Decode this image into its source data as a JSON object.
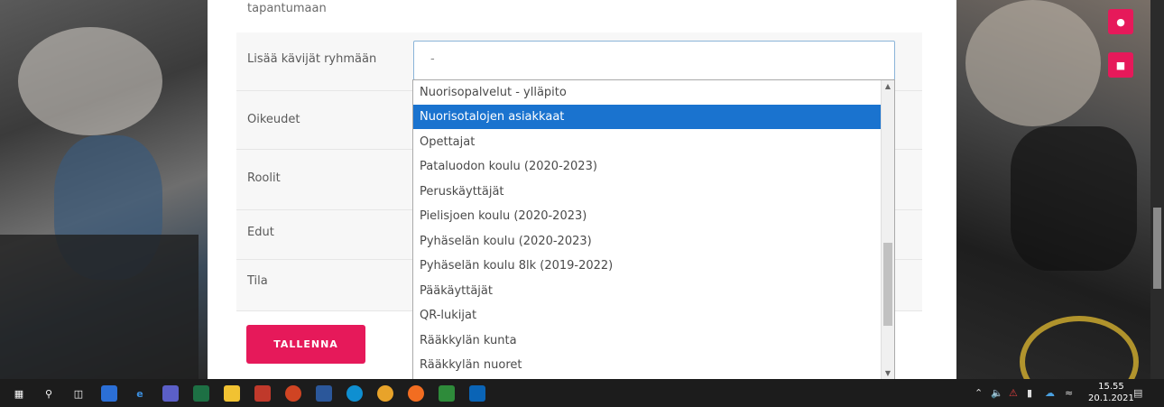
{
  "form": {
    "top_text": "tapantumaan",
    "rows": [
      {
        "label": "Lisää kävijät ryhmään"
      },
      {
        "label": "Oikeudet"
      },
      {
        "label": "Roolit"
      },
      {
        "label": "Edut"
      },
      {
        "label": "Tila"
      }
    ],
    "select_value": "-",
    "save_label": "TALLENNA"
  },
  "dropdown": {
    "options": [
      "Nuorisopalvelut - ylläpito",
      "Nuorisotalojen asiakkaat",
      "Opettajat",
      "Pataluodon koulu (2020-2023)",
      "Peruskäyttäjät",
      "Pielisjoen koulu (2020-2023)",
      "Pyhäselän koulu (2020-2023)",
      "Pyhäselän koulu 8lk (2019-2022)",
      "Pääkäyttäjät",
      "QR-lukijat",
      "Rääkkylän kunta",
      "Rääkkylän nuoret"
    ],
    "selected_index": 1,
    "colors": {
      "selected": "#1a73cf"
    }
  },
  "accent_color": "#e6195a",
  "taskbar": {
    "icons": [
      "windows-icon",
      "search-icon",
      "task-view-icon",
      "store-icon",
      "edge-legacy-icon",
      "teams-icon",
      "excel-icon",
      "file-explorer-icon",
      "pdf-icon",
      "powerpoint-icon",
      "word-icon",
      "edge-icon",
      "chrome-icon",
      "firefox-icon",
      "app-icon",
      "outlook-icon"
    ],
    "time": "15.55",
    "date": "20.1.2021"
  }
}
